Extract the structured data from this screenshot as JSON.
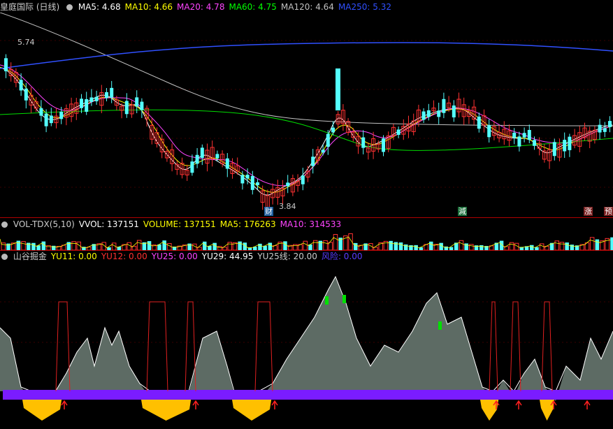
{
  "price_panel": {
    "title": "皇庭国际 (日线)",
    "ma_labels": [
      {
        "text": "MA5: 4.68",
        "color": "#ffffff"
      },
      {
        "text": "MA10: 4.66",
        "color": "#ffff00"
      },
      {
        "text": "MA20: 4.78",
        "color": "#ff44ff"
      },
      {
        "text": "MA60: 4.75",
        "color": "#00ff00"
      },
      {
        "text": "MA120: 4.64",
        "color": "#c0c0c0"
      },
      {
        "text": "MA250: 5.32",
        "color": "#3050ff"
      }
    ],
    "high_label": "5.74",
    "low_label": "3.84",
    "events": [
      {
        "text": "财",
        "bg": "#1f5f9f",
        "color": "#ffffff"
      },
      {
        "text": "減",
        "bg": "#1b6e3a",
        "color": "#ffffff"
      },
      {
        "text": "涨",
        "bg": "#7a2020",
        "color": "#ffffff"
      },
      {
        "text": "预",
        "bg": "#7a2020",
        "color": "#ffffff"
      }
    ]
  },
  "volume_panel": {
    "labels": [
      {
        "text": "VOL-TDX(5,10)",
        "color": "#cccccc"
      },
      {
        "text": "VVOL: 137151",
        "color": "#ffffff"
      },
      {
        "text": "VOLUME: 137151",
        "color": "#ffff00"
      },
      {
        "text": "MA5: 176263",
        "color": "#ffff00"
      },
      {
        "text": "MA10: 314533",
        "color": "#ff44ff"
      }
    ]
  },
  "indicator_panel": {
    "labels": [
      {
        "text": "山谷掘金",
        "color": "#cccccc"
      },
      {
        "text": "YU11: 0.00",
        "color": "#ffff00"
      },
      {
        "text": "YU12: 0.00",
        "color": "#ff3030"
      },
      {
        "text": "YU25: 0.00",
        "color": "#ff44ff"
      },
      {
        "text": "YU29: 44.95",
        "color": "#ffffff"
      },
      {
        "text": "YU25线: 20.00",
        "color": "#cccccc"
      },
      {
        "text": "风险: 0.00",
        "color": "#5a3cff"
      }
    ]
  },
  "colors": {
    "up": "#ff3232",
    "down": "#54ffff",
    "separator": "#b00000",
    "valley_fill": "#5d6b64",
    "gold_fill": "#ffc000",
    "risk_band": "#7a1cff"
  }
}
